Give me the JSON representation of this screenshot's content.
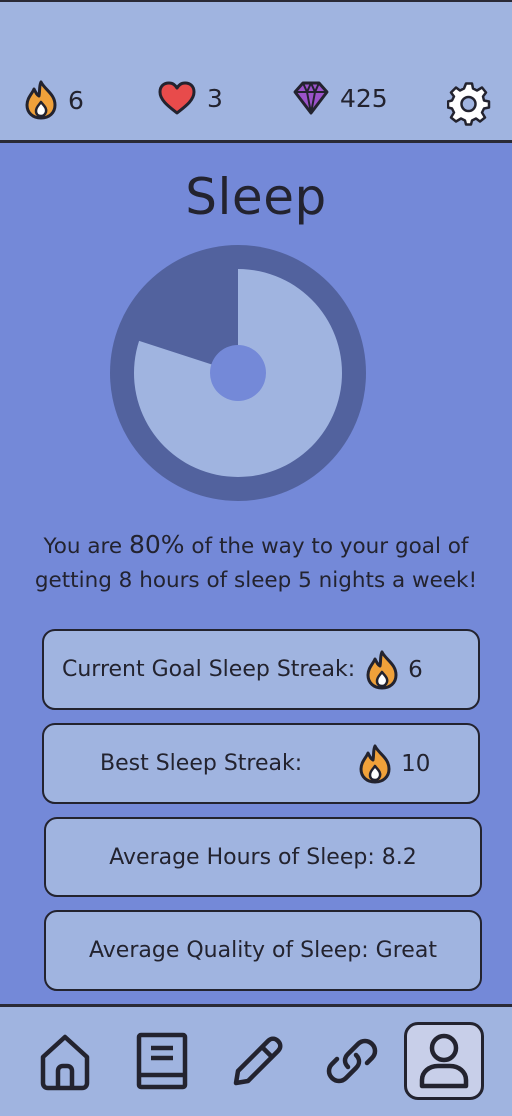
{
  "header": {
    "streak": {
      "icon": "fire-icon",
      "value": "6"
    },
    "lives": {
      "icon": "heart-icon",
      "value": "3"
    },
    "gems": {
      "icon": "gem-icon",
      "value": "425"
    },
    "settings_icon": "gear-icon"
  },
  "page": {
    "title": "Sleep",
    "progress_fraction": 0.8
  },
  "message": {
    "prefix": "You are ",
    "percent": "80%",
    "middle": " of the way to your goal of",
    "line2": "getting 8 hours of sleep  5 nights a week!"
  },
  "cards": {
    "current_streak": {
      "label": "Current Goal Sleep Streak:",
      "value": "6"
    },
    "best_streak": {
      "label": "Best Sleep Streak:",
      "value": "10"
    },
    "avg_hours": {
      "label": "Average Hours of Sleep:  8.2"
    },
    "avg_quality": {
      "label": "Average Quality of Sleep:  Great"
    }
  },
  "nav": {
    "items": [
      "home-icon",
      "journal-icon",
      "pencil-icon",
      "link-icon",
      "profile-icon"
    ],
    "active": "profile-icon"
  },
  "colors": {
    "background": "#7489d8",
    "bar": "#a0b4e0",
    "ring_track": "#52629e",
    "ring_fill": "#a0b4e0",
    "fire": "#f0a13a",
    "heart": "#e84b4b",
    "gem": "#9b53c9"
  }
}
